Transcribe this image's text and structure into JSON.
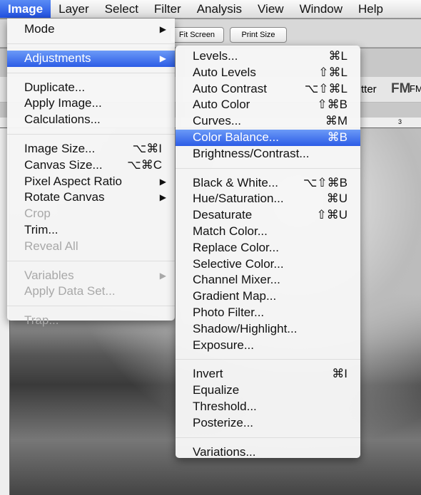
{
  "menubar": [
    "Image",
    "Layer",
    "Select",
    "Filter",
    "Analysis",
    "View",
    "Window",
    "Help"
  ],
  "options_bar": {
    "fit_screen": "Fit Screen",
    "print_size": "Print Size"
  },
  "background": {
    "tab_text": "tter",
    "logo": "FM",
    "logo_text": "FM",
    "ruler_number": "3"
  },
  "image_menu": [
    {
      "label": "Mode",
      "submenu": true
    },
    {
      "sep": true
    },
    {
      "label": "Adjustments",
      "submenu": true,
      "highlighted": true
    },
    {
      "sep": true
    },
    {
      "label": "Duplicate..."
    },
    {
      "label": "Apply Image..."
    },
    {
      "label": "Calculations..."
    },
    {
      "sep": true
    },
    {
      "label": "Image Size...",
      "shortcut": "⌥⌘I"
    },
    {
      "label": "Canvas Size...",
      "shortcut": "⌥⌘C"
    },
    {
      "label": "Pixel Aspect Ratio",
      "submenu": true
    },
    {
      "label": "Rotate Canvas",
      "submenu": true
    },
    {
      "label": "Crop",
      "disabled": true
    },
    {
      "label": "Trim..."
    },
    {
      "label": "Reveal All",
      "disabled": true
    },
    {
      "sep": true
    },
    {
      "label": "Variables",
      "submenu": true,
      "disabled": true
    },
    {
      "label": "Apply Data Set...",
      "disabled": true
    },
    {
      "sep": true
    },
    {
      "label": "Trap...",
      "disabled": true
    }
  ],
  "adjustments_menu": [
    {
      "label": "Levels...",
      "shortcut": "⌘L"
    },
    {
      "label": "Auto Levels",
      "shortcut": "⇧⌘L"
    },
    {
      "label": "Auto Contrast",
      "shortcut": "⌥⇧⌘L"
    },
    {
      "label": "Auto Color",
      "shortcut": "⇧⌘B"
    },
    {
      "label": "Curves...",
      "shortcut": "⌘M"
    },
    {
      "label": "Color Balance...",
      "shortcut": "⌘B",
      "highlighted": true
    },
    {
      "label": "Brightness/Contrast..."
    },
    {
      "sep": true
    },
    {
      "label": "Black & White...",
      "shortcut": "⌥⇧⌘B"
    },
    {
      "label": "Hue/Saturation...",
      "shortcut": "⌘U"
    },
    {
      "label": "Desaturate",
      "shortcut": "⇧⌘U"
    },
    {
      "label": "Match Color..."
    },
    {
      "label": "Replace Color..."
    },
    {
      "label": "Selective Color..."
    },
    {
      "label": "Channel Mixer..."
    },
    {
      "label": "Gradient Map..."
    },
    {
      "label": "Photo Filter..."
    },
    {
      "label": "Shadow/Highlight..."
    },
    {
      "label": "Exposure..."
    },
    {
      "sep": true
    },
    {
      "label": "Invert",
      "shortcut": "⌘I"
    },
    {
      "label": "Equalize"
    },
    {
      "label": "Threshold..."
    },
    {
      "label": "Posterize..."
    },
    {
      "sep": true
    },
    {
      "label": "Variations..."
    }
  ],
  "colors": {
    "highlight": "#2c5ce6"
  }
}
